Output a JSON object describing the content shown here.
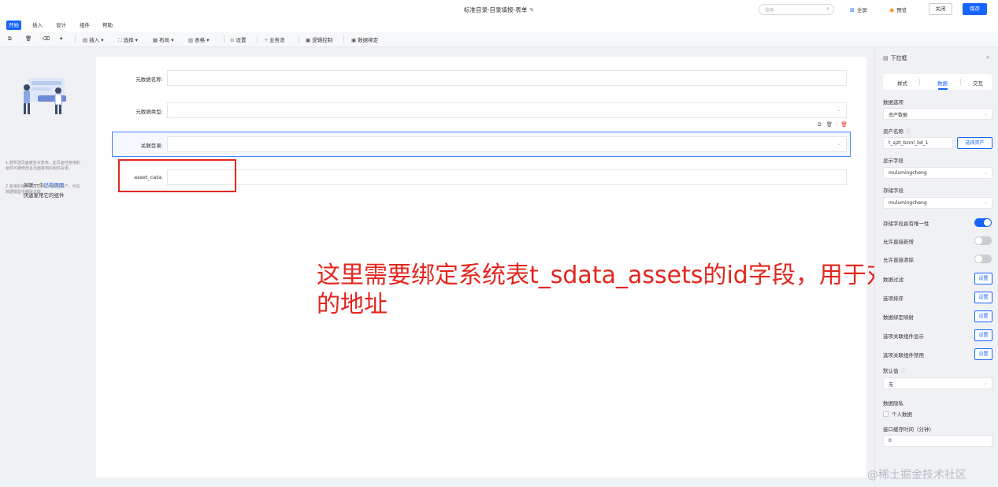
{
  "header": {
    "title": "标准目录-目录填报-表单",
    "search_placeholder": "搜索",
    "fullscreen_label": "全屏",
    "preview_label": "预览",
    "close_label": "关闭",
    "save_label": "保存"
  },
  "menu": {
    "tabs": [
      "开始",
      "插入",
      "设计",
      "组件",
      "帮助"
    ],
    "active": "开始"
  },
  "toolbar": {
    "items": [
      "插入 ▾",
      "选择 ▾",
      "布局 ▾",
      "表格 ▾",
      "设置",
      "业务流",
      "逻辑控制",
      "数据绑定"
    ]
  },
  "left_panel": {
    "line1_prefix": "关联一个",
    "line1_link": "已有页面",
    "line2": "快速复用它的组件",
    "tip1": "1.若所选页面被多次复用，此页面可复用的组件可被修改且页面复用的组件会更。",
    "tip2": "2.复用的组件将自动添加到数据资产，可在数据模型中删除关联。"
  },
  "form": {
    "fields": [
      {
        "label": "元数据名称:",
        "value": ""
      },
      {
        "label": "元数据类型:",
        "value": ""
      },
      {
        "label": "关联目录:",
        "value": ""
      },
      {
        "label": "asset_cata:",
        "value": ""
      }
    ]
  },
  "annotation": {
    "text_line1": "这里需要绑定系统表t_sdata_assets的id字段，用于对应资产",
    "text_line2": "的地址",
    "color": "#e3261f"
  },
  "right_panel": {
    "title": "下拉框",
    "tabs": [
      "样式",
      "数据",
      "交互"
    ],
    "active_tab": "数据",
    "data_source_label": "数据选项",
    "data_source_value": "资产数据",
    "asset_name_label": "资产名称",
    "asset_name_value": "t_sjzt_bzml_bd_1",
    "select_asset_label": "选择资产",
    "display_field_label": "显示字段",
    "display_field_value": "mulumingcheng",
    "store_field_label": "存储字段",
    "store_field_value": "mulumingcheng",
    "unique_label": "存储字段具有唯一性",
    "unique_on": true,
    "allow_add_label": "允许直接新增",
    "allow_add_on": false,
    "allow_clear_label": "允许直接清除",
    "allow_clear_on": false,
    "option_filter_label": "数据过滤",
    "option_sort_label": "选项排序",
    "data_map_label": "数据绑定映射",
    "linked_show_label": "选项关联组件显示",
    "linked_disable_label": "选项关联组件禁用",
    "set_label": "设置",
    "default_label": "默认值",
    "default_value": "无",
    "privacy_label": "数据隐私",
    "personal_label": "个人数据",
    "cache_label": "接口缓存时间（分钟）",
    "cache_value": "0"
  },
  "watermark": "@稀土掘金技术社区",
  "colors": {
    "accent": "#1664ff",
    "annotation": "#e3261f"
  }
}
